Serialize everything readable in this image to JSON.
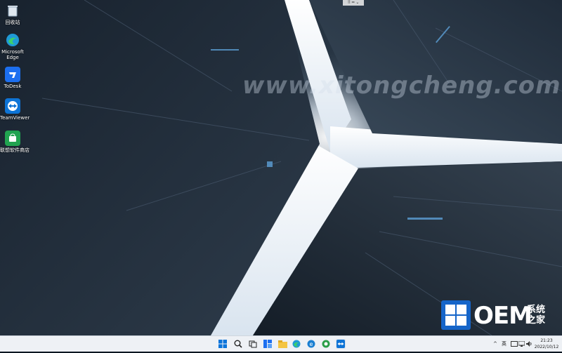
{
  "desktop": {
    "watermark": "www.xitongcheng.com",
    "icons": [
      {
        "label": "回收站",
        "icon": "recycle-bin-icon"
      },
      {
        "label": "Microsoft\nEdge",
        "icon": "edge-icon"
      },
      {
        "label": "ToDesk",
        "icon": "todesk-icon"
      },
      {
        "label": "TeamViewer",
        "icon": "teamviewer-icon"
      },
      {
        "label": "联想软件商店",
        "icon": "lenovo-store-icon"
      }
    ],
    "badge": {
      "brand": "OEM",
      "cn_text": "系统之家"
    }
  },
  "topbar": {
    "label": "⠿ ━ ⌄"
  },
  "taskbar": {
    "apps": [
      "start-icon",
      "search-icon",
      "task-view-icon",
      "widgets-icon",
      "file-explorer-icon",
      "edge-icon",
      "edge-icon",
      "app-icon",
      "store-icon",
      "teamviewer-icon"
    ],
    "tray": {
      "chevron": "^",
      "ime": "英",
      "time": "21:23",
      "date": "2022/10/12"
    }
  },
  "colors": {
    "accent": "#1565c9",
    "taskbar_bg": "#eef1f5"
  }
}
